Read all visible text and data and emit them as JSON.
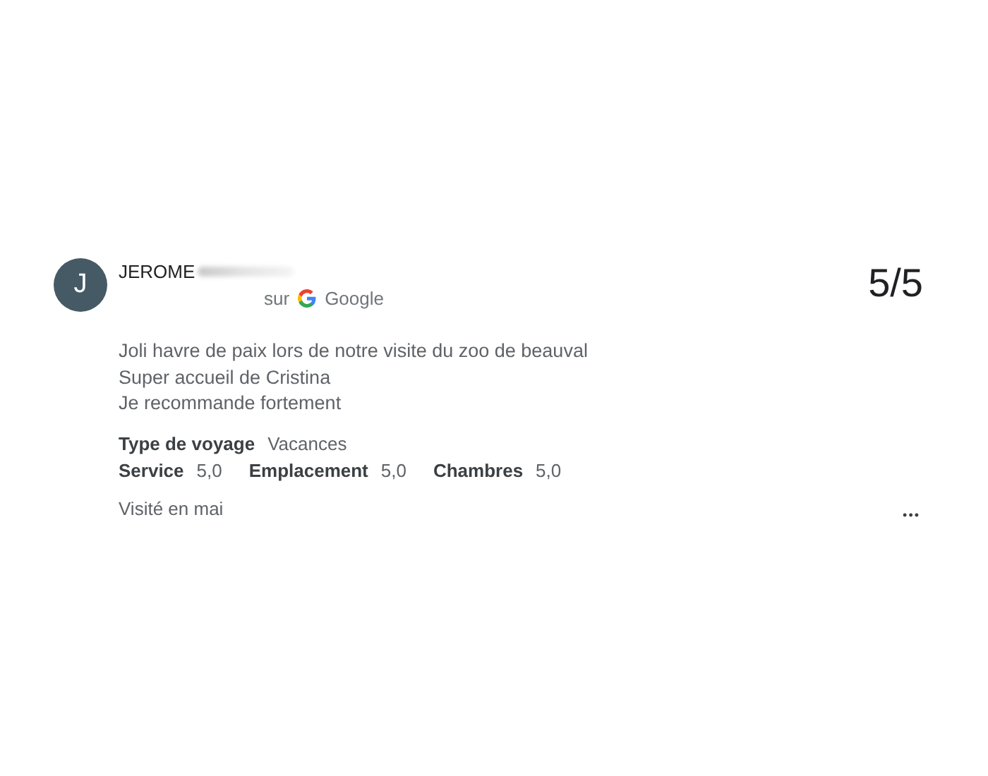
{
  "review": {
    "avatar_letter": "J",
    "author": "JEROME",
    "source_prefix": "sur",
    "source": "Google",
    "score": "5/5",
    "text_lines": [
      "Joli havre de paix lors de notre visite du zoo de beauval",
      "Super accueil de Cristina",
      "Je recommande fortement"
    ],
    "trip_type": {
      "label": "Type de voyage",
      "value": "Vacances"
    },
    "ratings": [
      {
        "label": "Service",
        "value": "5,0"
      },
      {
        "label": "Emplacement",
        "value": "5,0"
      },
      {
        "label": "Chambres",
        "value": "5,0"
      }
    ],
    "visited": "Visité en mai",
    "more": "•••"
  }
}
